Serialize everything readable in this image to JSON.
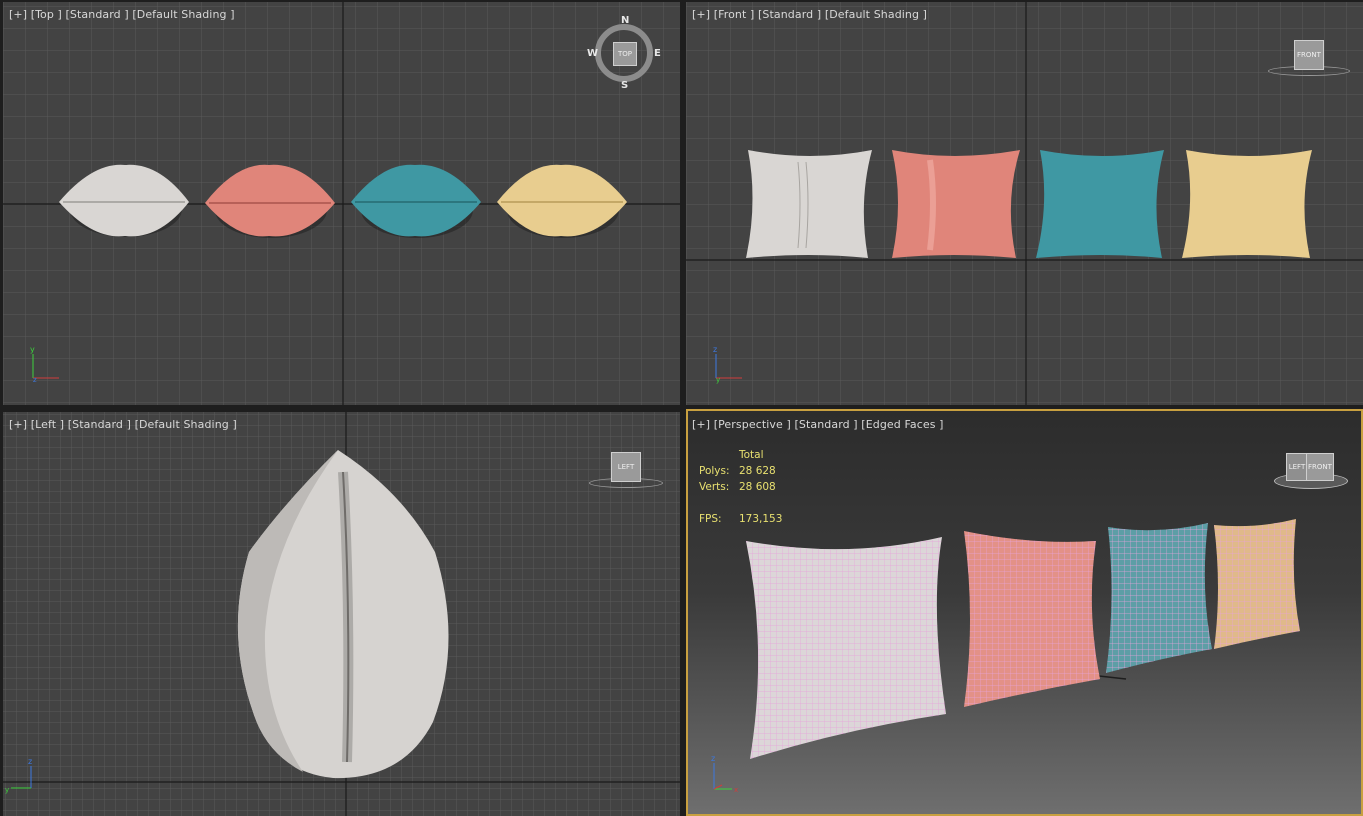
{
  "viewports": {
    "top": {
      "label": "[+] [Top ] [Standard ] [Default Shading ]",
      "cube_label": "TOP",
      "compass": {
        "n": "N",
        "s": "S",
        "e": "E",
        "w": "W"
      }
    },
    "front": {
      "label": "[+] [Front ] [Standard ] [Default Shading ]",
      "cube_label": "FRONT"
    },
    "left": {
      "label": "[+] [Left ] [Standard ] [Default Shading ]",
      "cube_label": "LEFT"
    },
    "perspective": {
      "label": "[+] [Perspective ] [Standard ] [Edged Faces ]",
      "cube_left": "LEFT",
      "cube_front": "FRONT",
      "stats": {
        "header": "Total",
        "polys_label": "Polys:",
        "polys": "28 628",
        "verts_label": "Verts:",
        "verts": "28 608",
        "fps_label": "FPS:",
        "fps": "173,153"
      }
    }
  },
  "axes": {
    "x": "x",
    "y": "y",
    "z": "z"
  },
  "pillow_colors": {
    "white": "#d9d6d3",
    "coral": "#e0857a",
    "teal": "#3f98a3",
    "sand": "#e8cd8f"
  },
  "colors": {
    "viewport_bg": "#434343",
    "active_border": "#c8a040",
    "wireframe": "#e8a2dc",
    "stats_text": "#e8e070"
  }
}
